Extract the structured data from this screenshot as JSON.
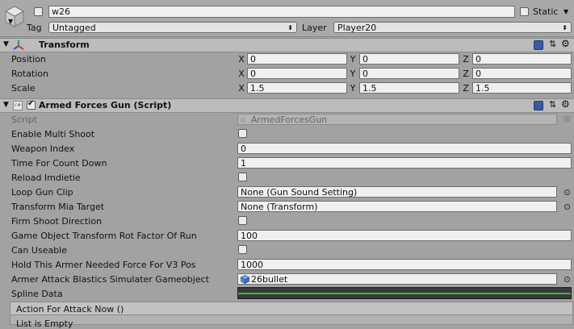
{
  "object": {
    "name": "w26",
    "static_label": "Static",
    "tag_label": "Tag",
    "tag_value": "Untagged",
    "layer_label": "Layer",
    "layer_value": "Player20"
  },
  "transform": {
    "title": "Transform",
    "rows": [
      {
        "label": "Position",
        "x": "0",
        "y": "0",
        "z": "0"
      },
      {
        "label": "Rotation",
        "x": "0",
        "y": "0",
        "z": "0"
      },
      {
        "label": "Scale",
        "x": "1.5",
        "y": "1.5",
        "z": "1.5"
      }
    ],
    "axes": {
      "x": "X",
      "y": "Y",
      "z": "Z"
    }
  },
  "script_component": {
    "title": "Armed Forces Gun (Script)",
    "icon_text": "c#",
    "fields": {
      "script": {
        "label": "Script",
        "value": "ArmedForcesGun"
      },
      "enable_multi_shoot": {
        "label": "Enable Multi Shoot"
      },
      "weapon_index": {
        "label": "Weapon Index",
        "value": "0"
      },
      "time_for_count_down": {
        "label": "Time For Count Down",
        "value": "1"
      },
      "reload_imdietie": {
        "label": "Reload Imdietie"
      },
      "loop_gun_clip": {
        "label": "Loop Gun Clip",
        "value": "None (Gun Sound Setting)"
      },
      "transform_mia_target": {
        "label": "Transform Mia Target",
        "value": "None (Transform)"
      },
      "firm_shoot_direction": {
        "label": "Firm Shoot Direction"
      },
      "rot_factor": {
        "label": "Game Object Transform Rot Factor Of Run",
        "value": "100"
      },
      "can_useable": {
        "label": "Can Useable"
      },
      "needed_force": {
        "label": "Hold This Armer Needed Force For V3 Pos",
        "value": "1000"
      },
      "blastics_simulater": {
        "label": "Armer Attack Blastics Simulater Gameobject",
        "value": "26bullet"
      },
      "spline_data": {
        "label": "Spline Data"
      }
    },
    "event": {
      "header": "Action For Attack Now ()",
      "empty_text": "List is Empty"
    }
  },
  "colors": {
    "panel_bg": "#a2a2a2",
    "header_bg": "#bcbcbc",
    "field_bg": "#f0f0f0",
    "curve_green": "#3fb93f",
    "accent_blue": "#3b5aa6"
  }
}
